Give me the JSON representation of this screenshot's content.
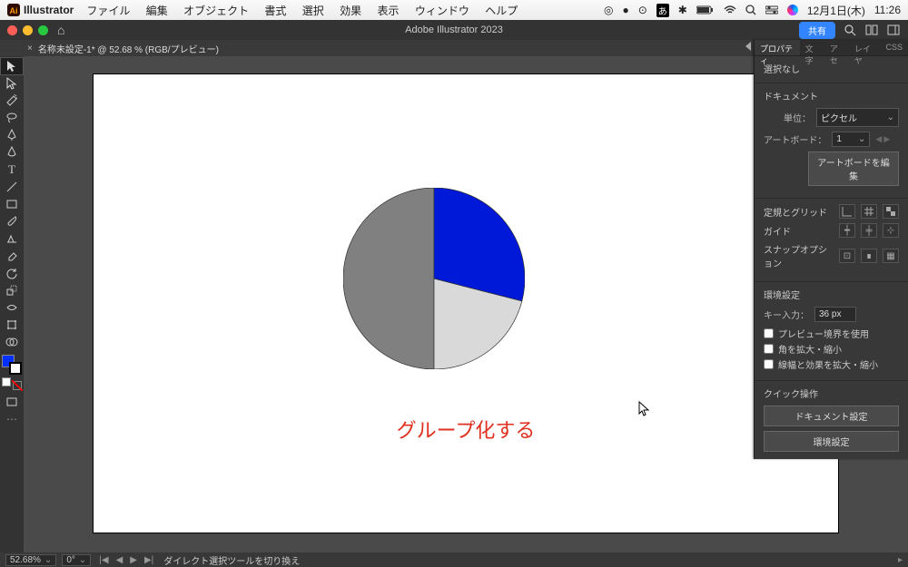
{
  "mac_menu": {
    "app": "Illustrator",
    "items": [
      "ファイル",
      "編集",
      "オブジェクト",
      "書式",
      "選択",
      "効果",
      "表示",
      "ウィンドウ",
      "ヘルプ"
    ],
    "date": "12月1日(木)",
    "time": "11:26"
  },
  "appbar": {
    "title": "Adobe Illustrator 2023",
    "share": "共有"
  },
  "tab": {
    "label": "名称未設定-1* @ 52.68 % (RGB/プレビュー)"
  },
  "canvas": {
    "caption": "グループ化する"
  },
  "panel": {
    "tabs": [
      "プロパティ",
      "文字",
      "アセ",
      "レイヤ",
      "CSS"
    ],
    "selection": "選択なし",
    "doc_header": "ドキュメント",
    "unit_label": "単位：",
    "unit_value": "ピクセル",
    "artboard_label": "アートボード：",
    "artboard_value": "1",
    "edit_artboards": "アートボードを編集",
    "ruler_grid": "定規とグリッド",
    "guides": "ガイド",
    "snap": "スナップオプション",
    "prefs": "環境設定",
    "keyinput_label": "キー入力：",
    "keyinput_value": "36 px",
    "chk_preview": "プレビュー境界を使用",
    "chk_corner": "角を拡大・縮小",
    "chk_stroke": "線幅と効果を拡大・縮小",
    "quick": "クイック操作",
    "docset": "ドキュメント設定",
    "envset": "環境設定"
  },
  "status": {
    "zoom": "52.68%",
    "rotate": "0°",
    "hint": "ダイレクト選択ツールを切り換え"
  },
  "chart_data": {
    "type": "pie",
    "title": "",
    "series": [
      {
        "name": "blue",
        "value": 29,
        "color": "#0018d8"
      },
      {
        "name": "light_gray",
        "value": 21,
        "color": "#d9d9d9"
      },
      {
        "name": "gray",
        "value": 50,
        "color": "#808080"
      }
    ]
  }
}
